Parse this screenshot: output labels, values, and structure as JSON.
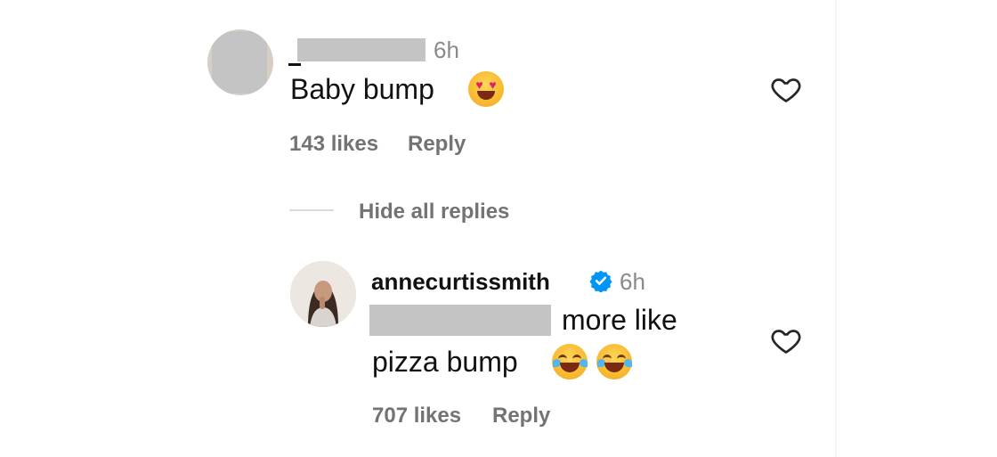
{
  "comment": {
    "time": "6h",
    "text": "Baby bump",
    "likes": "143 likes",
    "reply_label": "Reply"
  },
  "replies_toggle": "Hide all replies",
  "reply": {
    "username": "annecurtissmith",
    "time": "6h",
    "text_line1": "more like",
    "text_line2": "pizza bump",
    "likes": "707 likes",
    "reply_label": "Reply"
  },
  "colors": {
    "verified": "#0095f6",
    "secondary_text": "#737373"
  },
  "icons": [
    "heart-icon",
    "verified-badge-icon",
    "heart-eyes-emoji",
    "tears-of-joy-emoji"
  ]
}
